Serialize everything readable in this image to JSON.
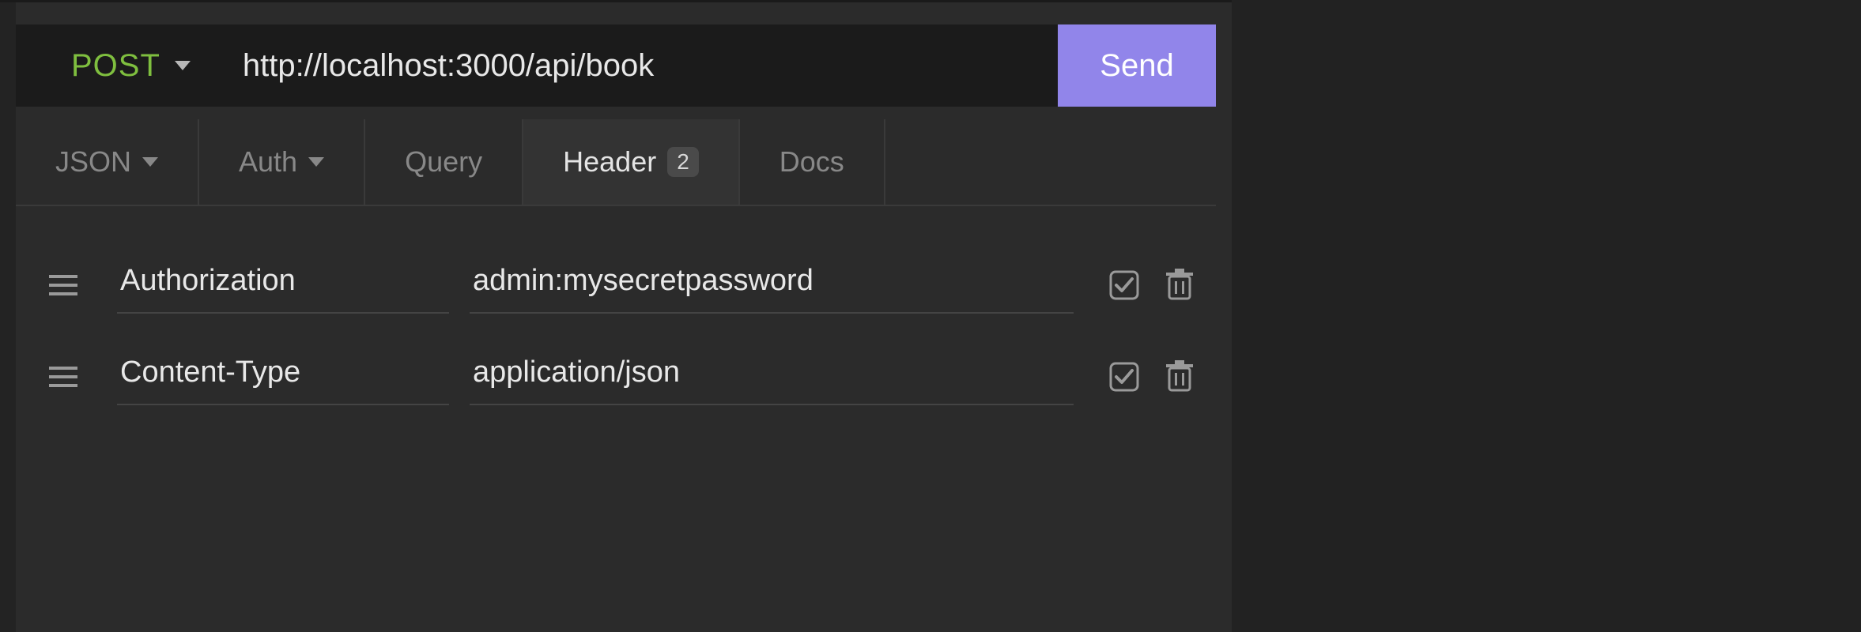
{
  "request": {
    "method": "POST",
    "url": "http://localhost:3000/api/book",
    "send_label": "Send"
  },
  "tabs": {
    "body": {
      "label": "JSON"
    },
    "auth": {
      "label": "Auth"
    },
    "query": {
      "label": "Query"
    },
    "header": {
      "label": "Header",
      "count": "2"
    },
    "docs": {
      "label": "Docs"
    }
  },
  "headers": [
    {
      "name": "Authorization",
      "value": "admin:mysecretpassword"
    },
    {
      "name": "Content-Type",
      "value": "application/json"
    }
  ],
  "icons": {
    "drag": "drag-handle-icon",
    "checkbox": "checkbox-checked-icon",
    "trash": "trash-icon",
    "caret": "chevron-down-icon"
  }
}
